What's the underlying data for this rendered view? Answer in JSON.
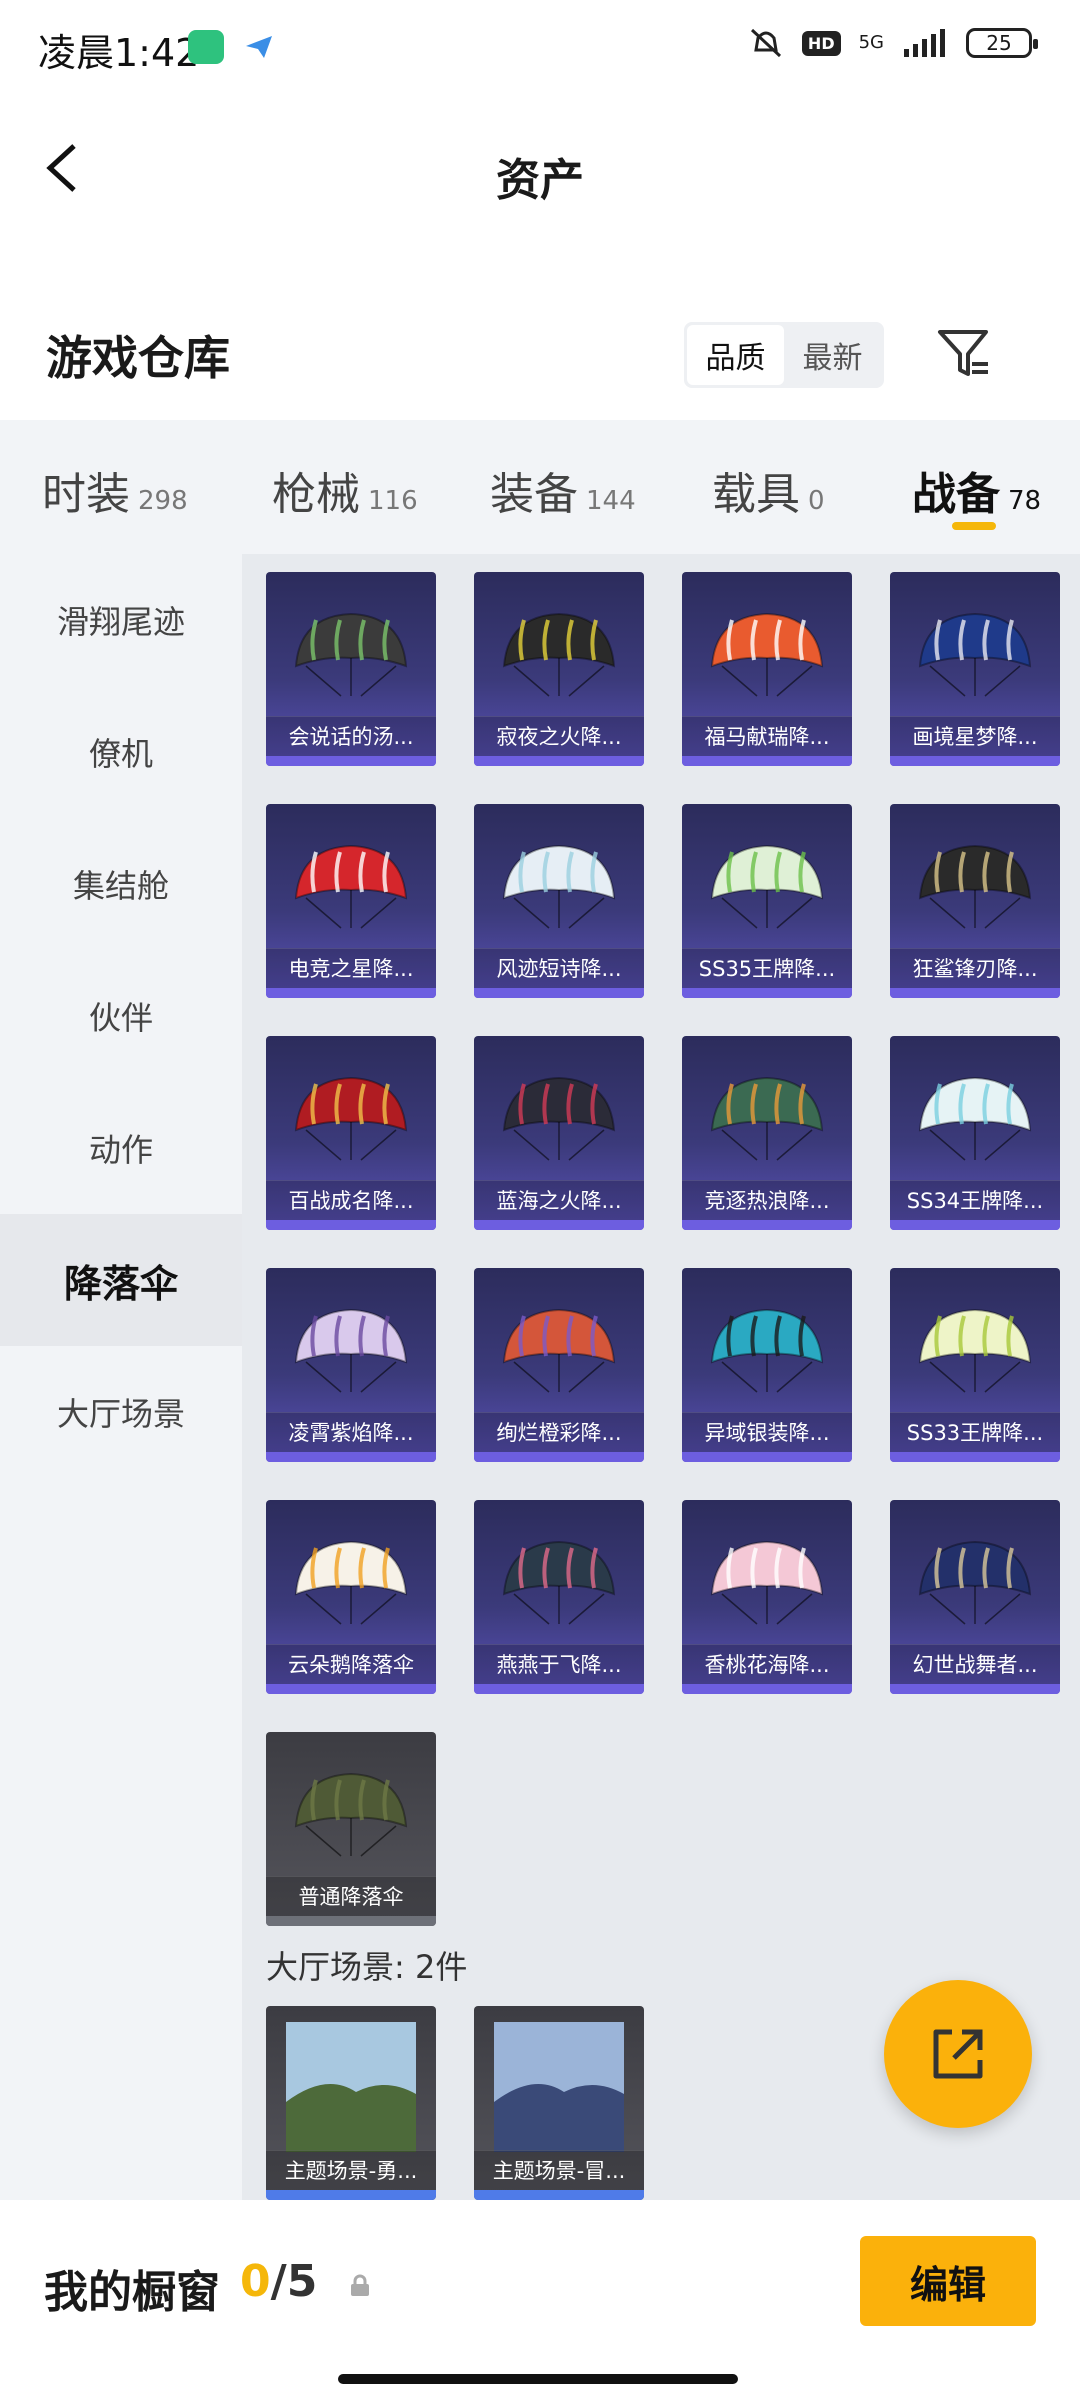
{
  "status": {
    "time": "凌晨1:42",
    "hd": "HD",
    "network": "5G",
    "battery": "25"
  },
  "header": {
    "title": "资产"
  },
  "warehouse": {
    "title": "游戏仓库",
    "sort": [
      "品质",
      "最新"
    ]
  },
  "tabs": [
    {
      "label": "时装",
      "count": "298"
    },
    {
      "label": "枪械",
      "count": "116"
    },
    {
      "label": "装备",
      "count": "144"
    },
    {
      "label": "载具",
      "count": "0"
    },
    {
      "label": "战备",
      "count": "78"
    }
  ],
  "sidebar": [
    "滑翔尾迹",
    "僚机",
    "集结舱",
    "伙伴",
    "动作",
    "降落伞",
    "大厅场景"
  ],
  "parachutes": [
    {
      "name": "会说话的汤...",
      "color": "#3b3b3b",
      "accent": "#7cc46b"
    },
    {
      "name": "寂夜之火降...",
      "color": "#2a2a2a",
      "accent": "#e5d23a"
    },
    {
      "name": "福马献瑞降...",
      "color": "#e95b2f",
      "accent": "#ffffff"
    },
    {
      "name": "画境星梦降...",
      "color": "#1f3a8a",
      "accent": "#e8e8f0"
    },
    {
      "name": "电竞之星降...",
      "color": "#d5262c",
      "accent": "#ffffff"
    },
    {
      "name": "风迹短诗降...",
      "color": "#e6eef5",
      "accent": "#9bd0e0"
    },
    {
      "name": "SS35王牌降...",
      "color": "#dff0d6",
      "accent": "#6cc04a"
    },
    {
      "name": "狂鲨锋刃降...",
      "color": "#2a2a2a",
      "accent": "#d8c48a"
    },
    {
      "name": "百战成名降...",
      "color": "#b01c22",
      "accent": "#f0c24a"
    },
    {
      "name": "蓝海之火降...",
      "color": "#2b2b38",
      "accent": "#d23b56"
    },
    {
      "name": "竞逐热浪降...",
      "color": "#3b6a52",
      "accent": "#e89a3a"
    },
    {
      "name": "SS34王牌降...",
      "color": "#e6f3f5",
      "accent": "#7ad0e0"
    },
    {
      "name": "凌霄紫焰降...",
      "color": "#d9c9ec",
      "accent": "#6a4aa0"
    },
    {
      "name": "绚烂橙彩降...",
      "color": "#d4563a",
      "accent": "#7a5ac8"
    },
    {
      "name": "异域银装降...",
      "color": "#2aa9c2",
      "accent": "#1a1a1a"
    },
    {
      "name": "SS33王牌降...",
      "color": "#eef4c8",
      "accent": "#a8c83a"
    },
    {
      "name": "云朵鹅降落伞",
      "color": "#f7f2e8",
      "accent": "#f0a020"
    },
    {
      "name": "燕燕于飞降...",
      "color": "#2a3a4a",
      "accent": "#e06a8a"
    },
    {
      "name": "香桃花海降...",
      "color": "#f4c8d6",
      "accent": "#ffffff"
    },
    {
      "name": "幻世战舞者...",
      "color": "#23306a",
      "accent": "#d8c89a"
    },
    {
      "name": "普通降落伞",
      "color": "#4f5a36",
      "accent": "#6d7846",
      "plain": true
    }
  ],
  "scenes_section": {
    "title": "大厅场景: 2件"
  },
  "scenes": [
    {
      "name": "主题场景-勇...",
      "sky": "#a8c8e0",
      "ground": "#4d6a3a"
    },
    {
      "name": "主题场景-冒...",
      "sky": "#9bb4d8",
      "ground": "#3a4a78"
    }
  ],
  "showcase": {
    "label": "我的橱窗",
    "current": "0",
    "max": "/5",
    "edit": "编辑"
  },
  "colors": {
    "accent": "#fbb10b",
    "card_bar": "#6d5ee0"
  }
}
